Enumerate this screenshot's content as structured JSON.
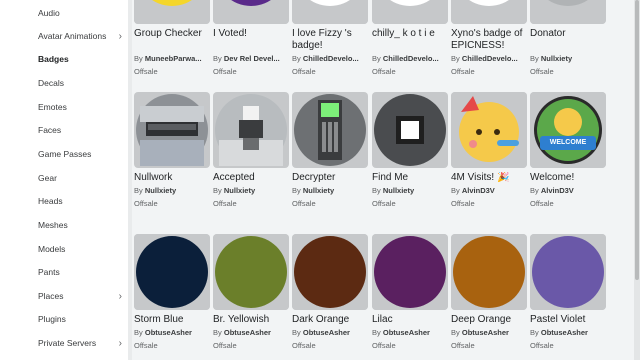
{
  "sidebar": {
    "items": [
      {
        "label": "Audio",
        "chevron": false,
        "active": false
      },
      {
        "label": "Avatar Animations",
        "chevron": true,
        "active": false
      },
      {
        "label": "Badges",
        "chevron": false,
        "active": true
      },
      {
        "label": "Decals",
        "chevron": false,
        "active": false
      },
      {
        "label": "Emotes",
        "chevron": false,
        "active": false
      },
      {
        "label": "Faces",
        "chevron": false,
        "active": false
      },
      {
        "label": "Game Passes",
        "chevron": false,
        "active": false
      },
      {
        "label": "Gear",
        "chevron": false,
        "active": false
      },
      {
        "label": "Heads",
        "chevron": false,
        "active": false
      },
      {
        "label": "Meshes",
        "chevron": false,
        "active": false
      },
      {
        "label": "Models",
        "chevron": false,
        "active": false
      },
      {
        "label": "Pants",
        "chevron": false,
        "active": false
      },
      {
        "label": "Places",
        "chevron": true,
        "active": false
      },
      {
        "label": "Plugins",
        "chevron": false,
        "active": false
      },
      {
        "label": "Private Servers",
        "chevron": true,
        "active": false
      }
    ],
    "chevron_glyph": "›"
  },
  "by_prefix": "By",
  "rows": [
    [
      {
        "name": "Group Checker",
        "creator": "MuneebParwa...",
        "price": "Offsale",
        "thumb": "yellow-smiley",
        "color": "#f4d62b"
      },
      {
        "name": "I Voted!",
        "creator": "Dev Rel Devel...",
        "price": "Offsale",
        "thumb": "purple-badge",
        "color": "#5a2a8a"
      },
      {
        "name": "I love Fizzy 's badge!",
        "creator": "ChilledDevelo...",
        "price": "Offsale",
        "thumb": "face-outline",
        "color": "#ffffff"
      },
      {
        "name": "chilly_ k o t i e",
        "creator": "ChilledDevelo...",
        "price": "Offsale",
        "thumb": "face-outline",
        "color": "#ffffff"
      },
      {
        "name": "Xyno's badge of EPICNESS!",
        "creator": "ChilledDevelo...",
        "price": "Offsale",
        "thumb": "face-outline",
        "color": "#ffffff"
      },
      {
        "name": "Donator",
        "creator": "Nullxiety",
        "price": "Offsale",
        "thumb": "grey-avatar",
        "color": "#b0b3b5"
      }
    ],
    [
      {
        "name": "Nullwork",
        "creator": "Nullxiety",
        "price": "Offsale",
        "thumb": "scene-machine",
        "color": "#8d9196"
      },
      {
        "name": "Accepted",
        "creator": "Nullxiety",
        "price": "Offsale",
        "thumb": "scene-avatar",
        "color": "#b8bcbf"
      },
      {
        "name": "Decrypter",
        "creator": "Nullxiety",
        "price": "Offsale",
        "thumb": "scene-device",
        "color": "#6d7073"
      },
      {
        "name": "Find Me",
        "creator": "Nullxiety",
        "price": "Offsale",
        "thumb": "scene-square",
        "color": "#4a4c4f"
      },
      {
        "name": "4M Visits! 🎉",
        "creator": "AlvinD3V",
        "price": "Offsale",
        "thumb": "party-emoji",
        "color": "#f5c94a"
      },
      {
        "name": "Welcome!",
        "creator": "AlvinD3V",
        "price": "Offsale",
        "thumb": "welcome-badge",
        "color": "#5ba84a"
      }
    ],
    [
      {
        "name": "Storm Blue",
        "creator": "ObtuseAsher",
        "price": "Offsale",
        "thumb": "color-circle",
        "color": "#0b1f3a"
      },
      {
        "name": "Br. Yellowish",
        "creator": "ObtuseAsher",
        "price": "Offsale",
        "thumb": "color-circle",
        "color": "#6b7f2a"
      },
      {
        "name": "Dark Orange",
        "creator": "ObtuseAsher",
        "price": "Offsale",
        "thumb": "color-circle",
        "color": "#5c2a12"
      },
      {
        "name": "Lilac",
        "creator": "ObtuseAsher",
        "price": "Offsale",
        "thumb": "color-circle",
        "color": "#5a2060"
      },
      {
        "name": "Deep Orange",
        "creator": "ObtuseAsher",
        "price": "Offsale",
        "thumb": "color-circle",
        "color": "#a8620f"
      },
      {
        "name": "Pastel Violet",
        "creator": "ObtuseAsher",
        "price": "Offsale",
        "thumb": "color-circle",
        "color": "#6a58a8"
      }
    ]
  ],
  "welcome_text": "WELCOME"
}
